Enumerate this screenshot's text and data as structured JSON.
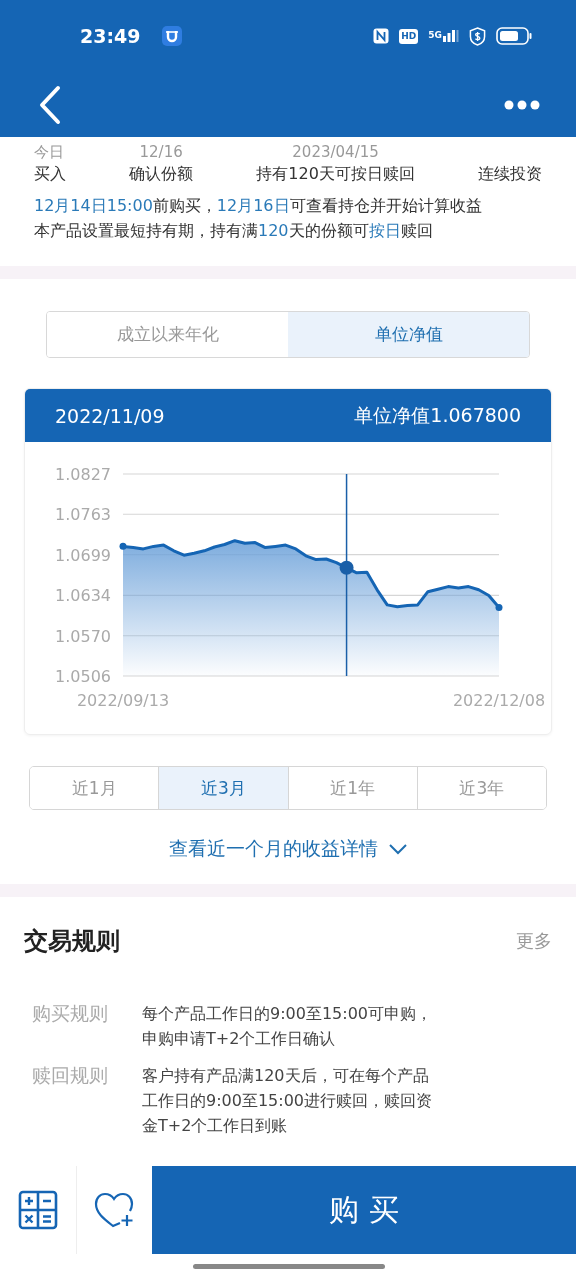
{
  "status_bar": {
    "time": "23:49",
    "hd": "HD",
    "network": "5G"
  },
  "timeline": [
    {
      "date": "今日",
      "label": "买入"
    },
    {
      "date": "12/16",
      "label": "确认份额"
    },
    {
      "date": "2023/04/15",
      "label": "持有120天可按日赎回"
    },
    {
      "label": "连续投资"
    }
  ],
  "notes": [
    [
      {
        "text": "12月14日15:00",
        "highlight": true
      },
      {
        "text": "前购买，",
        "highlight": false
      },
      {
        "text": "12月16日",
        "highlight": true
      },
      {
        "text": "可查看持仓并开始计算收益",
        "highlight": false
      }
    ],
    [
      {
        "text": "本产品设置最短持有期，持有满",
        "highlight": false
      },
      {
        "text": "120",
        "highlight": true
      },
      {
        "text": "天的份额可",
        "highlight": false
      },
      {
        "text": "按日",
        "highlight": true
      },
      {
        "text": "赎回",
        "highlight": false
      }
    ]
  ],
  "view_toggle": [
    {
      "label": "成立以来年化",
      "selected": false
    },
    {
      "label": "单位净值",
      "selected": true
    }
  ],
  "chart_card": {
    "date": "2022/11/09",
    "value": "单位净值1.067800",
    "chart_data": {
      "type": "area",
      "categories": [
        "2022/09/13",
        null,
        null,
        null,
        null,
        null,
        null,
        null,
        null,
        null,
        null,
        null,
        null,
        null,
        null,
        null,
        null,
        null,
        null,
        null,
        null,
        null,
        null,
        null,
        null,
        null,
        null,
        null,
        null,
        null,
        null,
        null,
        null,
        null,
        null,
        null,
        null,
        "2022/12/08"
      ],
      "series": [
        {
          "color": "#1565b4",
          "values": [
            1.0712,
            1.071,
            1.0708,
            1.0712,
            1.0714,
            1.0705,
            1.0698,
            1.0701,
            1.0705,
            1.0711,
            1.0715,
            1.0721,
            1.0717,
            1.0718,
            1.071,
            1.0712,
            1.0714,
            1.0708,
            1.0697,
            1.0691,
            1.0692,
            1.0686,
            1.0678,
            1.067,
            1.0671,
            1.0643,
            1.0619,
            1.0616,
            1.0618,
            1.0619,
            1.064,
            1.0644,
            1.0648,
            1.0646,
            1.0648,
            1.0643,
            1.0634,
            1.0615
          ]
        }
      ],
      "ylim": [
        1.0506,
        1.0827
      ],
      "yticks": [
        {
          "value": 1.0827,
          "label": "1.0827"
        },
        {
          "value": 1.0763,
          "label": "1.0763"
        },
        {
          "value": 1.0699,
          "label": "1.0699"
        },
        {
          "value": 1.0634,
          "label": "1.0634"
        },
        {
          "value": 1.057,
          "label": "1.0570"
        },
        {
          "value": 1.0506,
          "label": "1.0506"
        }
      ],
      "grid": true
    }
  },
  "periods": [
    {
      "label": "近1月",
      "selected": false
    },
    {
      "label": "近3月",
      "selected": true
    },
    {
      "label": "近1年",
      "selected": false
    },
    {
      "label": "近3年",
      "selected": false
    }
  ],
  "details_link": "查看近一个月的收益详情",
  "rules": {
    "title": "交易规则",
    "more": "更多",
    "items": [
      {
        "label": "购买规则",
        "text": "每个产品工作日的9:00至15:00可申购，申购申请T+2个工作日确认"
      },
      {
        "label": "赎回规则",
        "text": "客户持有产品满120天后，可在每个产品工作日的9:00至15:00进行赎回，赎回资金T+2个工作日到账"
      }
    ]
  },
  "buy_button": "购 买"
}
